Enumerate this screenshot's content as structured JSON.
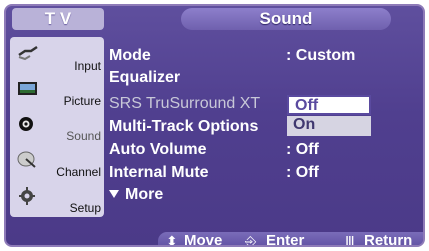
{
  "header": {
    "source_tab": "T V",
    "title": "Sound"
  },
  "sidebar": {
    "items": [
      {
        "label": "Input",
        "icon": "plug-icon",
        "active": false
      },
      {
        "label": "Picture",
        "icon": "picture-icon",
        "active": false
      },
      {
        "label": "Sound",
        "icon": "speaker-icon",
        "active": true
      },
      {
        "label": "Channel",
        "icon": "satellite-dish-icon",
        "active": false
      },
      {
        "label": "Setup",
        "icon": "gear-icon",
        "active": false
      }
    ]
  },
  "menu": {
    "rows": [
      {
        "label": "Mode",
        "value": ": Custom",
        "dim": false
      },
      {
        "label": "Equalizer",
        "value": "",
        "dim": false
      },
      {
        "label": "SRS TruSurround XT",
        "value": ":",
        "dim": true
      },
      {
        "label": "Multi-Track Options",
        "value": "",
        "dim": false
      },
      {
        "label": "Auto Volume",
        "value": ": Off",
        "dim": false
      },
      {
        "label": "Internal Mute",
        "value": ": Off",
        "dim": false
      },
      {
        "label": "More",
        "value": "",
        "dim": false
      }
    ],
    "dropdown": {
      "selected": "Off",
      "options": [
        "Off",
        "On"
      ]
    }
  },
  "footer": {
    "move_label": "Move",
    "enter_label": "Enter",
    "return_label": "Return",
    "move_icon": "updown-arrows-icon",
    "enter_icon": "enter-icon",
    "return_icon": "return-icon"
  },
  "colors": {
    "background": "#4f3f8f",
    "sidebar": "#d8d4ea",
    "accent": "#8d7fcb",
    "dropdown_selected_border": "#5a4a9f"
  }
}
